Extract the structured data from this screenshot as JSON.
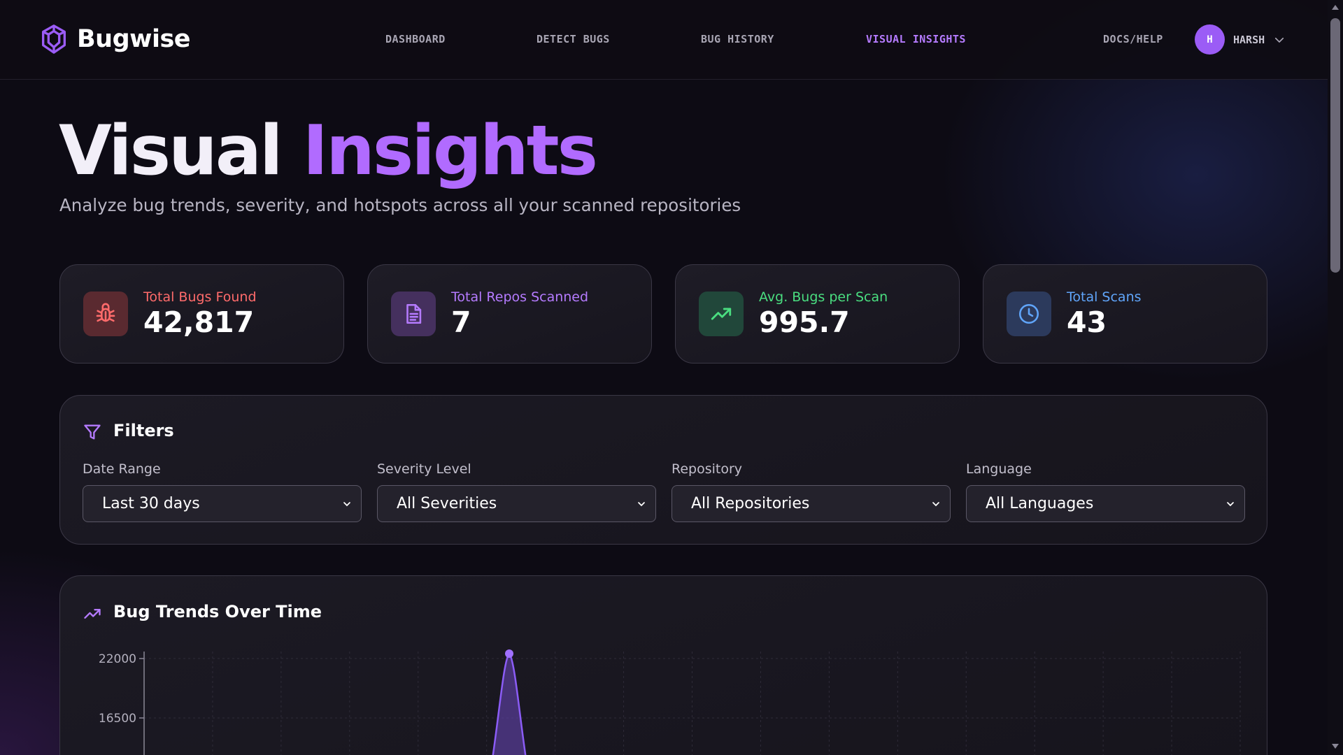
{
  "app": {
    "name": "Bugwise"
  },
  "nav": {
    "links": [
      {
        "label": "DASHBOARD",
        "active": false
      },
      {
        "label": "DETECT BUGS",
        "active": false
      },
      {
        "label": "BUG HISTORY",
        "active": false
      },
      {
        "label": "VISUAL INSIGHTS",
        "active": true
      }
    ],
    "help": "DOCS/HELP",
    "user": {
      "initial": "H",
      "name": "HARSH"
    }
  },
  "hero": {
    "title_part1": "Visual",
    "title_part2": "Insights",
    "subtitle": "Analyze bug trends, severity, and hotspots across all your scanned repositories"
  },
  "stats": [
    {
      "label": "Total Bugs Found",
      "value": "42,817",
      "icon": "bug-icon",
      "color": "#ff6b6b"
    },
    {
      "label": "Total Repos Scanned",
      "value": "7",
      "icon": "document-icon",
      "color": "#b57bff"
    },
    {
      "label": "Avg. Bugs per Scan",
      "value": "995.7",
      "icon": "trending-up-icon",
      "color": "#4ade80"
    },
    {
      "label": "Total Scans",
      "value": "43",
      "icon": "clock-icon",
      "color": "#60a5fa"
    }
  ],
  "filters": {
    "title": "Filters",
    "groups": [
      {
        "label": "Date Range",
        "value": "Last 30 days"
      },
      {
        "label": "Severity Level",
        "value": "All Severities"
      },
      {
        "label": "Repository",
        "value": "All Repositories"
      },
      {
        "label": "Language",
        "value": "All Languages"
      }
    ]
  },
  "trends": {
    "title": "Bug Trends Over Time"
  },
  "chart_data": {
    "type": "area",
    "title": "Bug Trends Over Time",
    "y_ticks": [
      22000,
      16500
    ],
    "peak": {
      "value": 22000
    },
    "color": "#8b5cf6"
  },
  "colors": {
    "accent": "#b16bff",
    "background": "#0d0b14"
  }
}
